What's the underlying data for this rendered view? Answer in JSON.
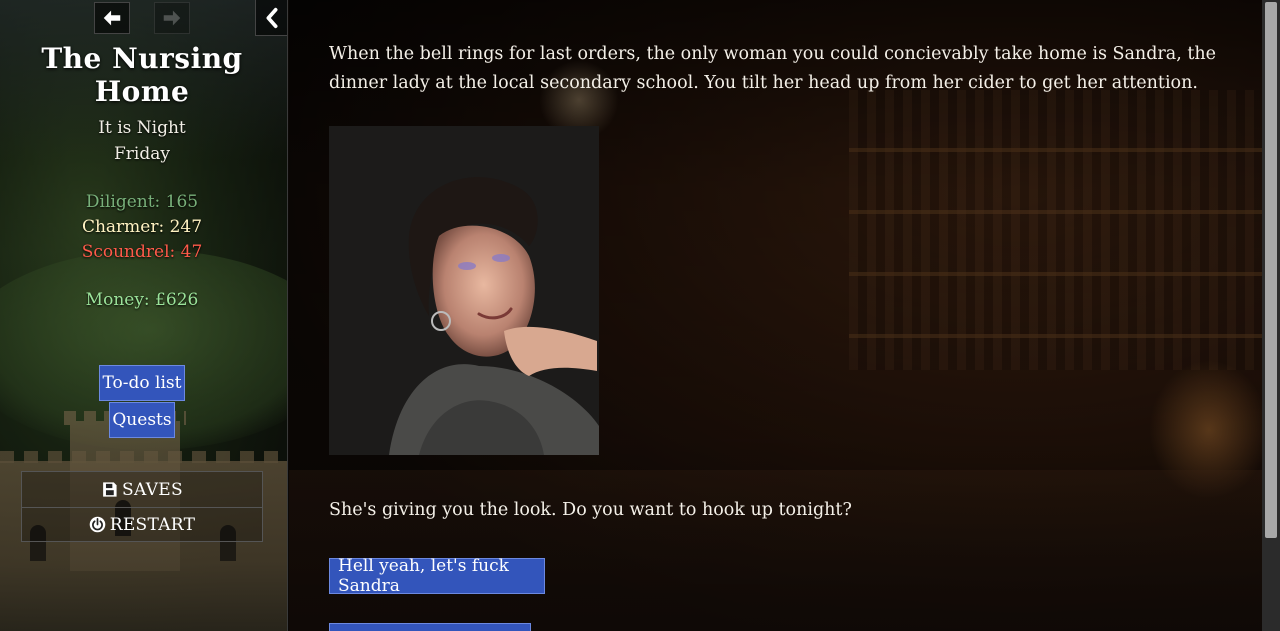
{
  "sidebar": {
    "title": "The Nursing Home",
    "time_of_day": "It is Night",
    "day": "Friday",
    "stats": {
      "diligent": "Diligent: 165",
      "charmer": "Charmer: 247",
      "scoundrel": "Scoundrel: 47"
    },
    "money": "Money: £626",
    "buttons": {
      "todo": "To-do list",
      "quests": "Quests"
    },
    "menu": {
      "saves": "SAVES",
      "restart": "RESTART"
    },
    "nav_icons": {
      "back": "arrow-left-icon",
      "forward": "arrow-right-icon",
      "collapse": "chevron-left-icon"
    }
  },
  "passage": {
    "paragraph1": "When the bell rings for last orders, the only woman you could concievably take home is Sandra, the dinner lady at the local secondary school. You tilt her head up from her cider to get her attention.",
    "paragraph2": "She's giving you the look. Do you want to hook up tonight?",
    "choices": [
      {
        "label": "Hell yeah, let's fuck Sandra"
      },
      {
        "label": ""
      }
    ]
  },
  "colors": {
    "button_blue": "#3355bb",
    "diligent": "#78b07a",
    "charmer": "#fff3c2",
    "scoundrel": "#ff5a4a",
    "money": "#9be39a"
  }
}
